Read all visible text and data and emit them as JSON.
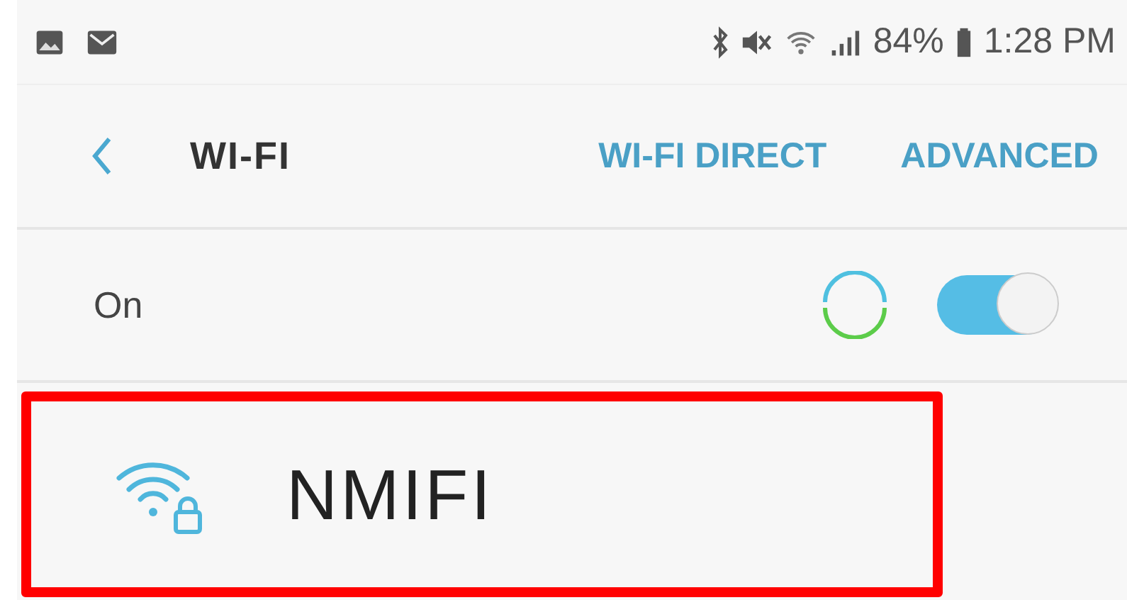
{
  "status_bar": {
    "battery": "84%",
    "time": "1:28 PM"
  },
  "header": {
    "title": "WI-FI",
    "actions": [
      {
        "label": "WI-FI DIRECT"
      },
      {
        "label": "ADVANCED"
      }
    ]
  },
  "master": {
    "label": "On",
    "on": true,
    "scanning": true
  },
  "networks": [
    {
      "name": "NMIFI",
      "secured": true,
      "highlighted": true
    }
  ]
}
